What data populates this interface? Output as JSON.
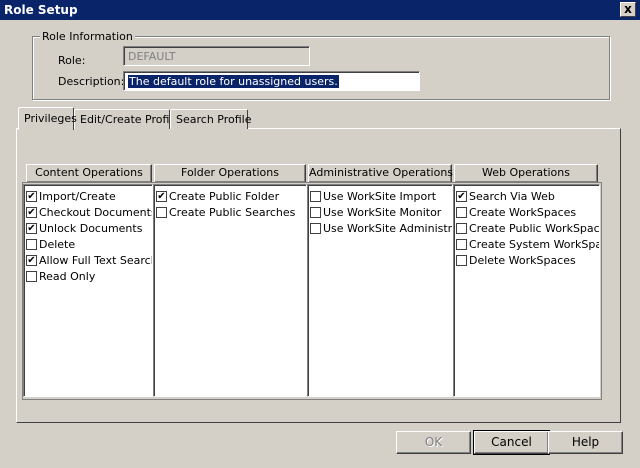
{
  "window": {
    "title": "Role Setup",
    "close_glyph": "x"
  },
  "role_info": {
    "group_title": "Role Information",
    "role_label": "Role:",
    "role_value": "DEFAULT",
    "description_label": "Description:",
    "description_value": "The default role for unassigned users."
  },
  "tabs": [
    {
      "label": "Privileges",
      "active": true
    },
    {
      "label": "Edit/Create Profile",
      "active": false
    },
    {
      "label": "Search Profile",
      "active": false
    }
  ],
  "columns": [
    {
      "header": "Content Operations",
      "items": [
        {
          "label": "Import/Create",
          "checked": true
        },
        {
          "label": "Checkout Documents",
          "checked": true
        },
        {
          "label": "Unlock Documents",
          "checked": true
        },
        {
          "label": "Delete",
          "checked": false
        },
        {
          "label": "Allow Full Text Search",
          "checked": true
        },
        {
          "label": "Read Only",
          "checked": false
        }
      ]
    },
    {
      "header": "Folder Operations",
      "items": [
        {
          "label": "Create Public Folder",
          "checked": true
        },
        {
          "label": "Create Public Searches",
          "checked": false
        }
      ]
    },
    {
      "header": "Administrative Operations",
      "items": [
        {
          "label": "Use WorkSite Import",
          "checked": false
        },
        {
          "label": "Use WorkSite Monitor",
          "checked": false
        },
        {
          "label": "Use WorkSite Administration",
          "checked": false
        }
      ]
    },
    {
      "header": "Web Operations",
      "items": [
        {
          "label": "Search Via Web",
          "checked": true
        },
        {
          "label": "Create WorkSpaces",
          "checked": false
        },
        {
          "label": "Create Public WorkSpaces",
          "checked": false
        },
        {
          "label": "Create System WorkSpaces",
          "checked": false
        },
        {
          "label": "Delete WorkSpaces",
          "checked": false
        }
      ]
    }
  ],
  "buttons": {
    "ok": "OK",
    "cancel": "Cancel",
    "help": "Help"
  },
  "check_glyph": "✔"
}
